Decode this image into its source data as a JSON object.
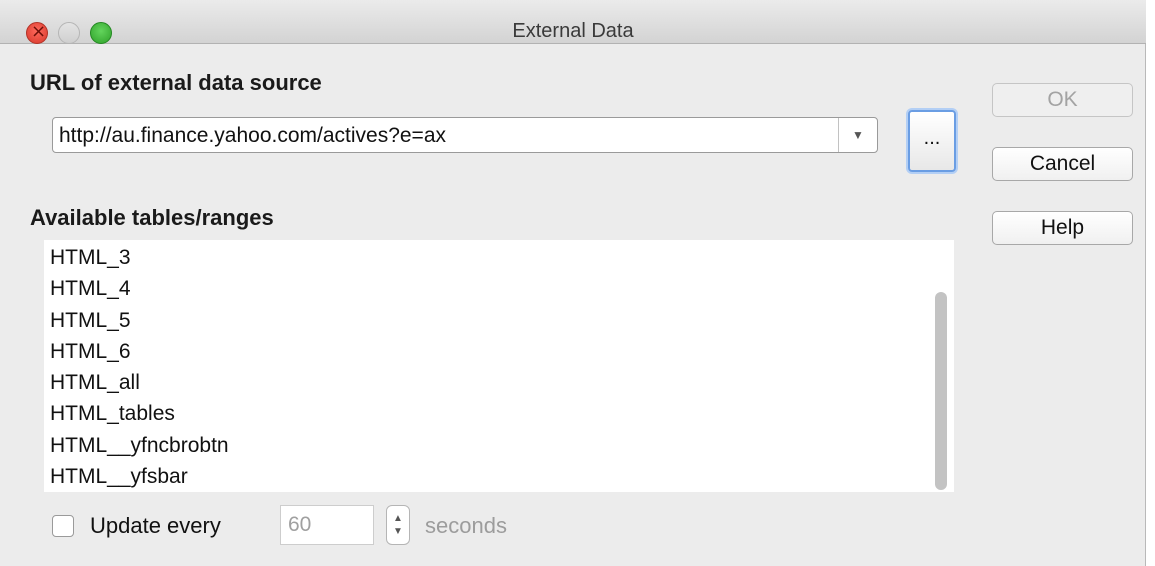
{
  "window": {
    "title": "External Data"
  },
  "source": {
    "label": "URL of external data source",
    "url": "http://au.finance.yahoo.com/actives?e=ax",
    "dropdown_icon": "▼",
    "browse_label": "..."
  },
  "buttons": {
    "ok": "OK",
    "cancel": "Cancel",
    "help": "Help"
  },
  "tables": {
    "label": "Available tables/ranges",
    "items": [
      "HTML_3",
      "HTML_4",
      "HTML_5",
      "HTML_6",
      "HTML_all",
      "HTML_tables",
      "HTML__yfncbrobtn",
      "HTML__yfsbar"
    ]
  },
  "update": {
    "label": "Update every",
    "checked": false,
    "value": "60",
    "unit": "seconds",
    "spin_up": "▲",
    "spin_down": "▼"
  }
}
